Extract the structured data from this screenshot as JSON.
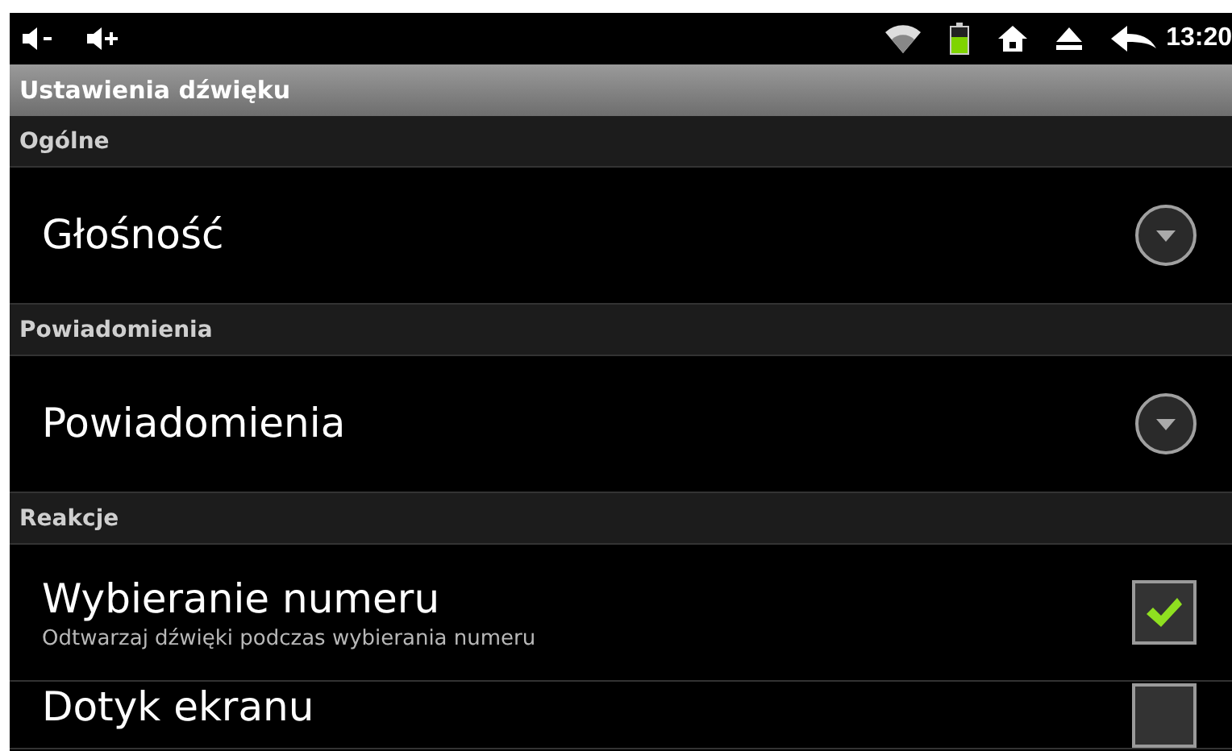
{
  "status_bar": {
    "time": "13:20"
  },
  "title": "Ustawienia dźwięku",
  "sections": [
    {
      "header": "Ogólne",
      "items": [
        {
          "kind": "dropdown",
          "title": "Głośność"
        }
      ]
    },
    {
      "header": "Powiadomienia",
      "items": [
        {
          "kind": "dropdown",
          "title": "Powiadomienia"
        }
      ]
    },
    {
      "header": "Reakcje",
      "items": [
        {
          "kind": "checkbox",
          "title": "Wybieranie numeru",
          "summary": "Odtwarzaj dźwięki podczas wybierania numeru",
          "checked": true
        },
        {
          "kind": "checkbox",
          "title": "Dotyk ekranu",
          "checked": false
        }
      ]
    }
  ]
}
